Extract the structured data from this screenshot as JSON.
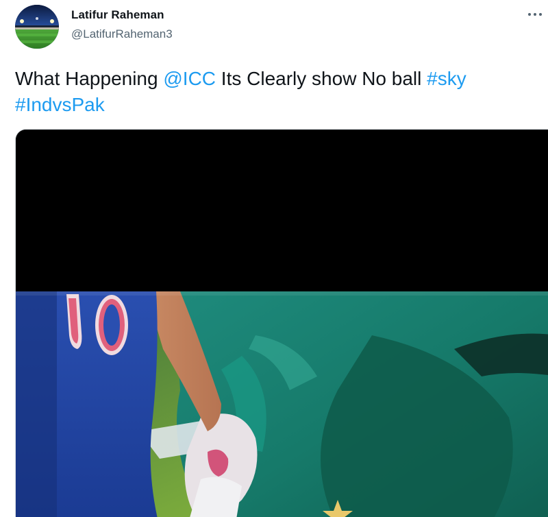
{
  "tweet": {
    "author_name": "Latifur Raheman",
    "author_handle": "@LatifurRaheman3",
    "text_part1": "What Happening ",
    "mention": "@ICC",
    "text_part2": " Its Clearly show No ball ",
    "hashtag1": "#sky",
    "hashtag2": "#IndvsPak"
  },
  "icons": {
    "avatar": "stadium-avatar",
    "more": "more-horizontal-icon"
  },
  "colors": {
    "link": "#1d9bf0",
    "text": "#0f1419",
    "secondary": "#536471"
  }
}
